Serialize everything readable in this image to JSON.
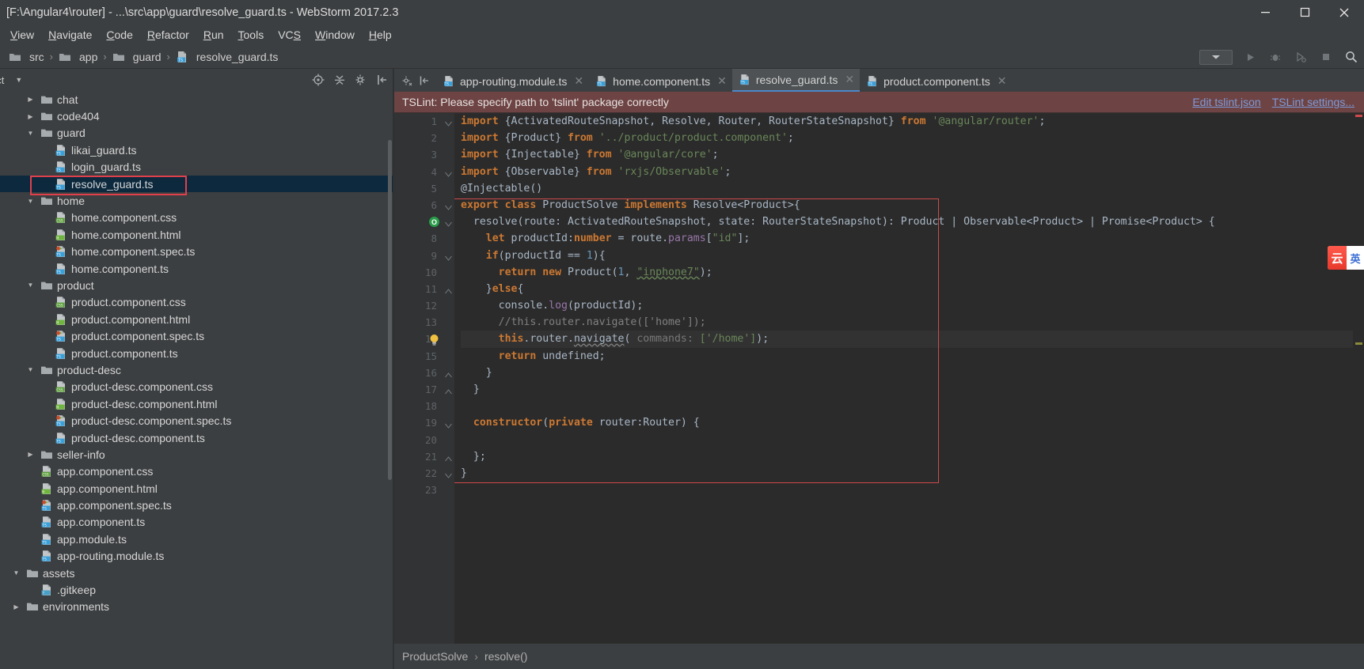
{
  "window": {
    "title": "[F:\\Angular4\\router] - ...\\src\\app\\guard\\resolve_guard.ts - WebStorm 2017.2.3",
    "minimize": "—",
    "maximize": "☐",
    "close": "✕"
  },
  "menu": [
    {
      "label": "View",
      "accel": "V"
    },
    {
      "label": "Navigate",
      "accel": "N"
    },
    {
      "label": "Code",
      "accel": "C"
    },
    {
      "label": "Refactor",
      "accel": "R"
    },
    {
      "label": "Run",
      "accel": "R"
    },
    {
      "label": "Tools",
      "accel": "T"
    },
    {
      "label": "VCS",
      "accel": "S"
    },
    {
      "label": "Window",
      "accel": "W"
    },
    {
      "label": "Help",
      "accel": "H"
    }
  ],
  "breadcrumb": {
    "items": [
      "src",
      "app",
      "guard",
      "resolve_guard.ts"
    ],
    "separator": "›"
  },
  "toolbar": {
    "run_config_label": "",
    "run_icon": "run-icon",
    "debug_icon": "debug-icon",
    "coverage_icon": "coverage-icon",
    "stop_icon": "stop-icon",
    "search_icon": "search-icon"
  },
  "sidebar": {
    "title": "ect",
    "tools": [
      "target-icon",
      "collapse-all-icon",
      "gear-icon",
      "hide-icon"
    ],
    "tree": [
      {
        "label": "chat",
        "type": "folder",
        "indent": 1,
        "arrow": "collapsed",
        "clipped": true
      },
      {
        "label": "code404",
        "type": "folder",
        "indent": 1,
        "arrow": "collapsed"
      },
      {
        "label": "guard",
        "type": "folder",
        "indent": 1,
        "arrow": "expanded"
      },
      {
        "label": "likai_guard.ts",
        "type": "ts",
        "indent": 2,
        "arrow": "none"
      },
      {
        "label": "login_guard.ts",
        "type": "ts",
        "indent": 2,
        "arrow": "none"
      },
      {
        "label": "resolve_guard.ts",
        "type": "ts",
        "indent": 2,
        "arrow": "none",
        "selected": true,
        "highlighted": true
      },
      {
        "label": "home",
        "type": "folder",
        "indent": 1,
        "arrow": "expanded"
      },
      {
        "label": "home.component.css",
        "type": "css",
        "indent": 2,
        "arrow": "none"
      },
      {
        "label": "home.component.html",
        "type": "html",
        "indent": 2,
        "arrow": "none"
      },
      {
        "label": "home.component.spec.ts",
        "type": "spec",
        "indent": 2,
        "arrow": "none"
      },
      {
        "label": "home.component.ts",
        "type": "ts",
        "indent": 2,
        "arrow": "none"
      },
      {
        "label": "product",
        "type": "folder",
        "indent": 1,
        "arrow": "expanded"
      },
      {
        "label": "product.component.css",
        "type": "css",
        "indent": 2,
        "arrow": "none"
      },
      {
        "label": "product.component.html",
        "type": "html",
        "indent": 2,
        "arrow": "none"
      },
      {
        "label": "product.component.spec.ts",
        "type": "spec",
        "indent": 2,
        "arrow": "none"
      },
      {
        "label": "product.component.ts",
        "type": "ts",
        "indent": 2,
        "arrow": "none"
      },
      {
        "label": "product-desc",
        "type": "folder",
        "indent": 1,
        "arrow": "expanded"
      },
      {
        "label": "product-desc.component.css",
        "type": "css",
        "indent": 2,
        "arrow": "none"
      },
      {
        "label": "product-desc.component.html",
        "type": "html",
        "indent": 2,
        "arrow": "none"
      },
      {
        "label": "product-desc.component.spec.ts",
        "type": "spec",
        "indent": 2,
        "arrow": "none"
      },
      {
        "label": "product-desc.component.ts",
        "type": "ts",
        "indent": 2,
        "arrow": "none"
      },
      {
        "label": "seller-info",
        "type": "folder",
        "indent": 1,
        "arrow": "collapsed"
      },
      {
        "label": "app.component.css",
        "type": "css",
        "indent": 1,
        "arrow": "none"
      },
      {
        "label": "app.component.html",
        "type": "html",
        "indent": 1,
        "arrow": "none"
      },
      {
        "label": "app.component.spec.ts",
        "type": "spec",
        "indent": 1,
        "arrow": "none"
      },
      {
        "label": "app.component.ts",
        "type": "ts",
        "indent": 1,
        "arrow": "none"
      },
      {
        "label": "app.module.ts",
        "type": "ts",
        "indent": 1,
        "arrow": "none"
      },
      {
        "label": "app-routing.module.ts",
        "type": "ts",
        "indent": 1,
        "arrow": "none"
      },
      {
        "label": "assets",
        "type": "folder",
        "indent": 0,
        "arrow": "expanded"
      },
      {
        "label": ".gitkeep",
        "type": "unknown",
        "indent": 1,
        "arrow": "none"
      },
      {
        "label": "environments",
        "type": "folder",
        "indent": 0,
        "arrow": "collapsed",
        "clipped": true
      }
    ]
  },
  "tabs": [
    {
      "label": "app-routing.module.ts",
      "type": "ts",
      "active": false,
      "close": "✕"
    },
    {
      "label": "home.component.ts",
      "type": "ts",
      "active": false,
      "close": "✕"
    },
    {
      "label": "resolve_guard.ts",
      "type": "ts",
      "active": true,
      "close": "✕"
    },
    {
      "label": "product.component.ts",
      "type": "ts",
      "active": false,
      "close": "✕"
    }
  ],
  "lint_banner": {
    "message": "TSLint: Please specify path to 'tslint' package correctly",
    "links": [
      "Edit tslint.json",
      "TSLint settings..."
    ]
  },
  "editor": {
    "line_numbers": [
      1,
      2,
      3,
      4,
      5,
      6,
      7,
      8,
      9,
      10,
      11,
      12,
      13,
      14,
      15,
      16,
      17,
      18,
      19,
      20,
      21,
      22,
      23
    ],
    "current_line": 14,
    "lines": [
      {
        "n": 1,
        "tokens": [
          {
            "t": "import",
            "c": "kw"
          },
          {
            "t": " {ActivatedRouteSnapshot, Resolve, Router, RouterStateSnapshot} ",
            "c": "pl"
          },
          {
            "t": "from",
            "c": "kw"
          },
          {
            "t": " ",
            "c": "pl"
          },
          {
            "t": "'@angular/router'",
            "c": "str"
          },
          {
            "t": ";",
            "c": "pl"
          }
        ]
      },
      {
        "n": 2,
        "tokens": [
          {
            "t": "import",
            "c": "kw"
          },
          {
            "t": " {Product} ",
            "c": "pl"
          },
          {
            "t": "from",
            "c": "kw"
          },
          {
            "t": " ",
            "c": "pl"
          },
          {
            "t": "'../product/product.component'",
            "c": "str"
          },
          {
            "t": ";",
            "c": "pl"
          }
        ]
      },
      {
        "n": 3,
        "tokens": [
          {
            "t": "import",
            "c": "kw"
          },
          {
            "t": " {Injectable} ",
            "c": "pl"
          },
          {
            "t": "from",
            "c": "kw"
          },
          {
            "t": " ",
            "c": "pl"
          },
          {
            "t": "'@angular/core'",
            "c": "str"
          },
          {
            "t": ";",
            "c": "pl"
          }
        ]
      },
      {
        "n": 4,
        "tokens": [
          {
            "t": "import",
            "c": "kw"
          },
          {
            "t": " {Observable} ",
            "c": "pl"
          },
          {
            "t": "from",
            "c": "kw"
          },
          {
            "t": " ",
            "c": "pl"
          },
          {
            "t": "'rxjs/Observable'",
            "c": "str"
          },
          {
            "t": ";",
            "c": "pl"
          }
        ]
      },
      {
        "n": 5,
        "tokens": [
          {
            "t": "@Injectable()",
            "c": "pl"
          }
        ]
      },
      {
        "n": 6,
        "tokens": [
          {
            "t": "export class",
            "c": "kw"
          },
          {
            "t": " ProductSolve ",
            "c": "pl"
          },
          {
            "t": "implements",
            "c": "kw"
          },
          {
            "t": " Resolve<Product>{",
            "c": "pl"
          }
        ]
      },
      {
        "n": 7,
        "tokens": [
          {
            "t": "  resolve(route: ActivatedRouteSnapshot, state: RouterStateSnapshot): Product | Observable<Product> | Promise<Product> {",
            "c": "pl"
          }
        ]
      },
      {
        "n": 8,
        "tokens": [
          {
            "t": "    ",
            "c": "pl"
          },
          {
            "t": "let",
            "c": "kw"
          },
          {
            "t": " productId:",
            "c": "pl"
          },
          {
            "t": "number",
            "c": "kw"
          },
          {
            "t": " = route.",
            "c": "pl"
          },
          {
            "t": "params",
            "c": "fld"
          },
          {
            "t": "[",
            "c": "pl"
          },
          {
            "t": "\"id\"",
            "c": "str"
          },
          {
            "t": "];",
            "c": "pl"
          }
        ]
      },
      {
        "n": 9,
        "tokens": [
          {
            "t": "    ",
            "c": "pl"
          },
          {
            "t": "if",
            "c": "kw"
          },
          {
            "t": "(productId == ",
            "c": "pl"
          },
          {
            "t": "1",
            "c": "num"
          },
          {
            "t": "){",
            "c": "pl"
          }
        ]
      },
      {
        "n": 10,
        "tokens": [
          {
            "t": "      ",
            "c": "pl"
          },
          {
            "t": "return new",
            "c": "kw"
          },
          {
            "t": " Product(",
            "c": "pl"
          },
          {
            "t": "1",
            "c": "num"
          },
          {
            "t": ", ",
            "c": "pl"
          },
          {
            "t": "\"inphone7\"",
            "c": "str-wavy"
          },
          {
            "t": ");",
            "c": "pl"
          }
        ]
      },
      {
        "n": 11,
        "tokens": [
          {
            "t": "    }",
            "c": "pl"
          },
          {
            "t": "else",
            "c": "kw"
          },
          {
            "t": "{",
            "c": "pl"
          }
        ]
      },
      {
        "n": 12,
        "tokens": [
          {
            "t": "      console.",
            "c": "pl"
          },
          {
            "t": "log",
            "c": "fld"
          },
          {
            "t": "(productId);",
            "c": "pl"
          }
        ]
      },
      {
        "n": 13,
        "tokens": [
          {
            "t": "      //this.router.navigate(['home']);",
            "c": "cmt"
          }
        ]
      },
      {
        "n": 14,
        "tokens": [
          {
            "t": "      ",
            "c": "pl"
          },
          {
            "t": "this",
            "c": "kw"
          },
          {
            "t": ".router.",
            "c": "pl"
          },
          {
            "t": "navigate",
            "c": "pl-wavy"
          },
          {
            "t": "( ",
            "c": "pl"
          },
          {
            "t": "commands:",
            "c": "hint"
          },
          {
            "t": " ",
            "c": "pl"
          },
          {
            "t": "['/home']",
            "c": "str"
          },
          {
            "t": ");",
            "c": "pl"
          }
        ]
      },
      {
        "n": 15,
        "tokens": [
          {
            "t": "      ",
            "c": "pl"
          },
          {
            "t": "return",
            "c": "kw"
          },
          {
            "t": " undefined;",
            "c": "pl"
          }
        ]
      },
      {
        "n": 16,
        "tokens": [
          {
            "t": "    }",
            "c": "pl"
          }
        ]
      },
      {
        "n": 17,
        "tokens": [
          {
            "t": "  }",
            "c": "pl"
          }
        ]
      },
      {
        "n": 18,
        "tokens": [
          {
            "t": "",
            "c": "pl"
          }
        ]
      },
      {
        "n": 19,
        "tokens": [
          {
            "t": "  ",
            "c": "pl"
          },
          {
            "t": "constructor",
            "c": "kw"
          },
          {
            "t": "(",
            "c": "pl"
          },
          {
            "t": "private",
            "c": "kw"
          },
          {
            "t": " router:Router) {",
            "c": "pl"
          }
        ]
      },
      {
        "n": 20,
        "tokens": [
          {
            "t": "",
            "c": "pl"
          }
        ]
      },
      {
        "n": 21,
        "tokens": [
          {
            "t": "  };",
            "c": "pl"
          }
        ]
      },
      {
        "n": 22,
        "tokens": [
          {
            "t": "}",
            "c": "pl"
          }
        ]
      },
      {
        "n": 23,
        "tokens": [
          {
            "t": "",
            "c": "pl"
          }
        ]
      }
    ],
    "gutter_markers": [
      {
        "line": 7,
        "type": "implementing-method-icon",
        "glyph": "O"
      },
      {
        "line": 14,
        "type": "intention-bulb-icon"
      }
    ]
  },
  "float_widget": {
    "left_glyph": "云",
    "right_glyph": "英",
    "name": "ime-indicator"
  },
  "status": {
    "breadcrumb": [
      "ProductSolve",
      "resolve()"
    ],
    "separator": "›"
  },
  "colors": {
    "accent": "#4a88c7",
    "lint_bg": "#6e4343",
    "selection": "#0d293e",
    "highlight_border": "#e0404c",
    "editor_bg": "#2b2b2b",
    "chrome_bg": "#3c3f41"
  }
}
